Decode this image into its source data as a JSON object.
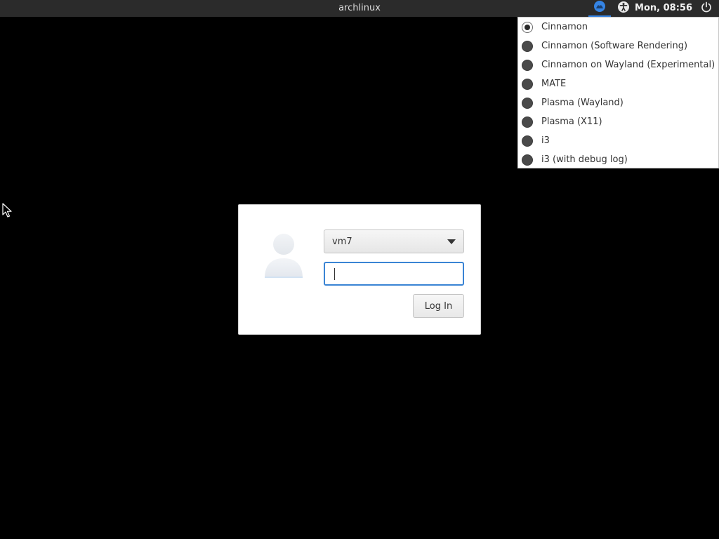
{
  "top_panel": {
    "hostname": "archlinux",
    "clock": "Mon, 08:56",
    "indicators": {
      "session_icon": "session-icon",
      "accessibility_icon": "accessibility-icon",
      "power_icon": "power-icon"
    },
    "accent_color": "#3584e4"
  },
  "session_menu": {
    "items": [
      {
        "label": "Cinnamon",
        "selected": true
      },
      {
        "label": "Cinnamon (Software Rendering)",
        "selected": false
      },
      {
        "label": "Cinnamon on Wayland (Experimental)",
        "selected": false
      },
      {
        "label": "MATE",
        "selected": false
      },
      {
        "label": "Plasma (Wayland)",
        "selected": false
      },
      {
        "label": "Plasma (X11)",
        "selected": false
      },
      {
        "label": "i3",
        "selected": false
      },
      {
        "label": "i3 (with debug log)",
        "selected": false
      }
    ]
  },
  "login": {
    "avatar_icon": "user-avatar-icon",
    "user_select": {
      "value": "vm7"
    },
    "password": {
      "value": "",
      "placeholder": ""
    },
    "login_button_label": "Log In",
    "focus_color": "#3a84d4"
  }
}
